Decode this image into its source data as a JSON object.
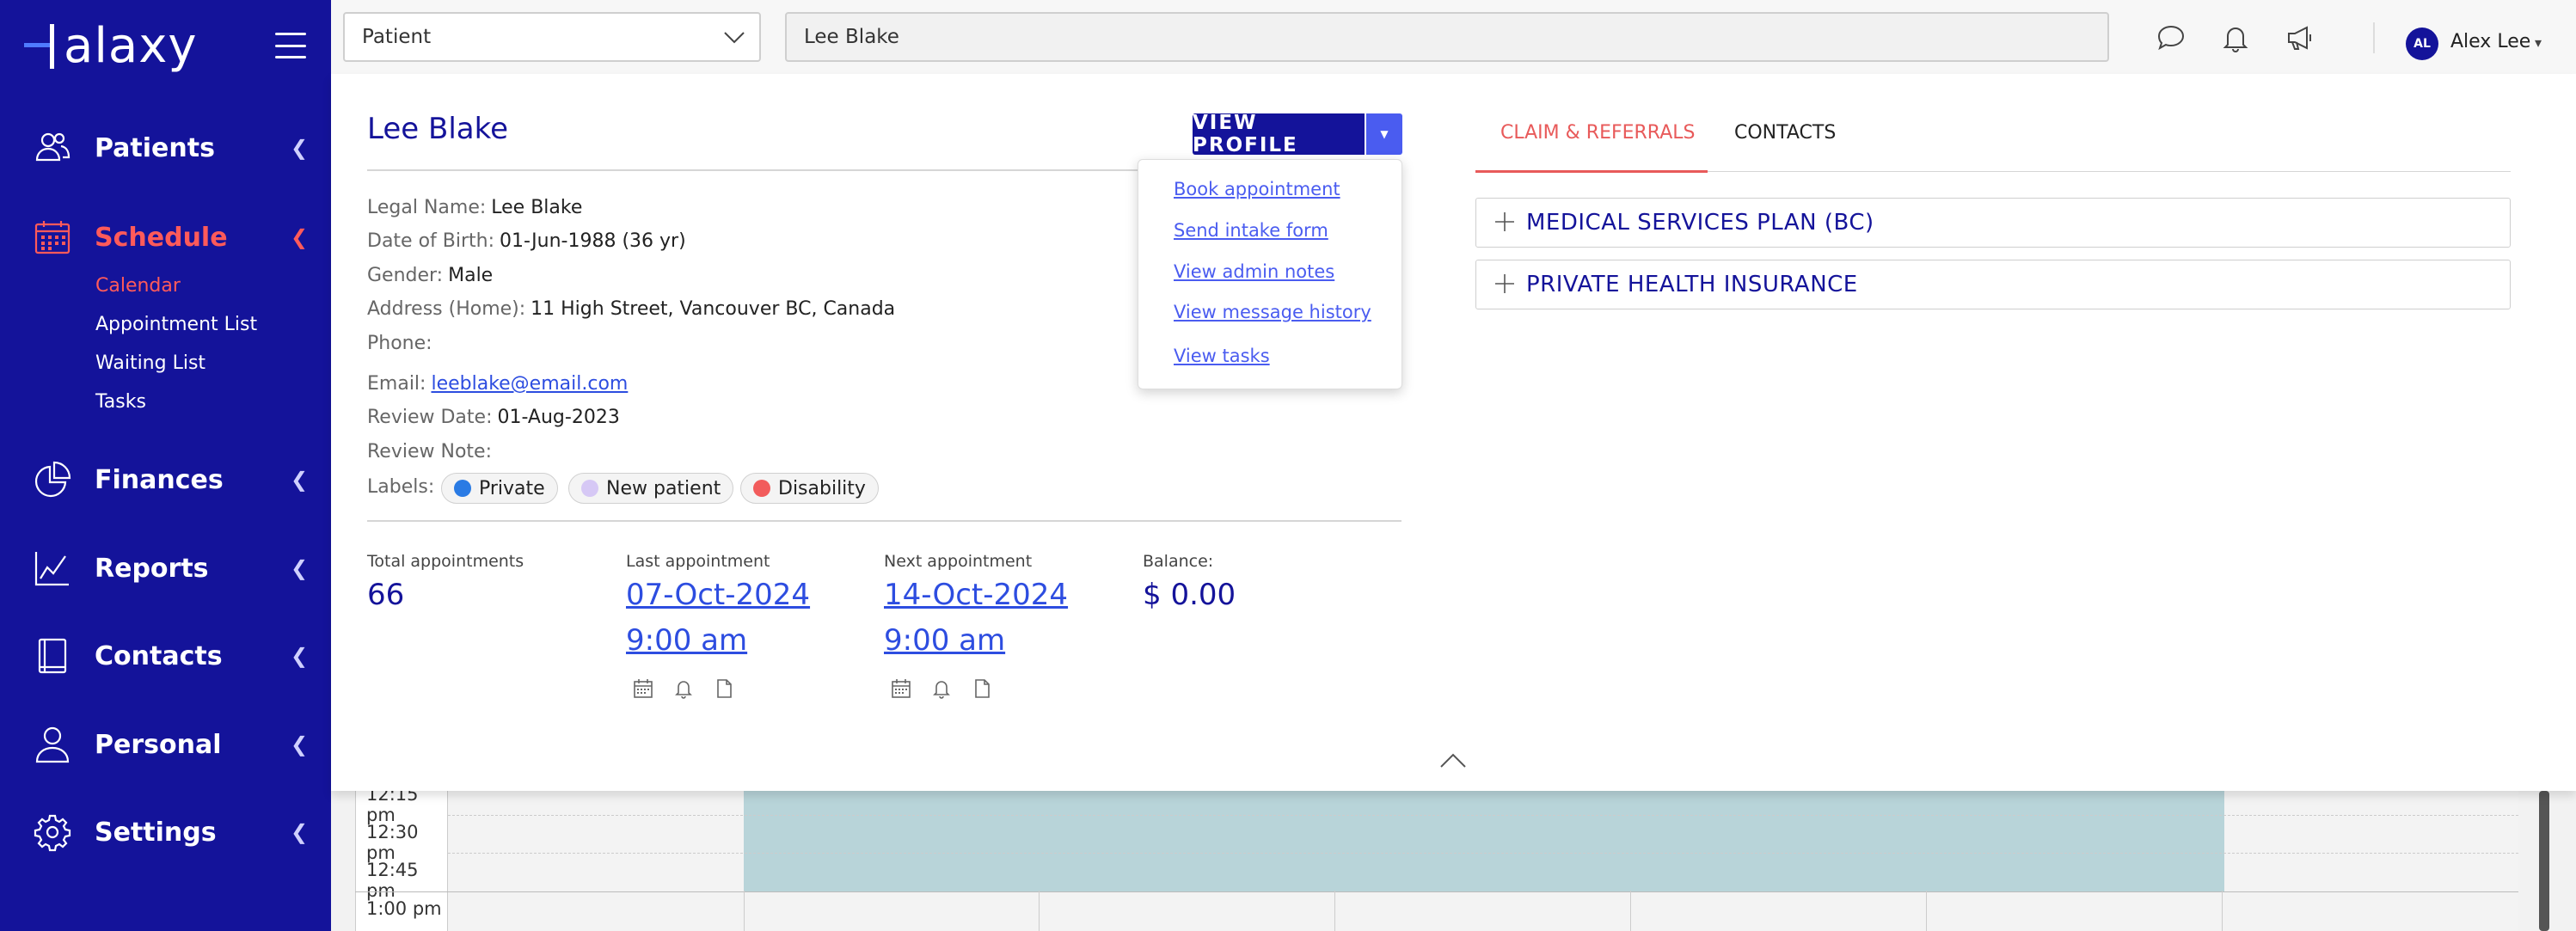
{
  "brand": {
    "logo_text": "alaxy"
  },
  "sidebar": {
    "items": [
      {
        "label": "Patients",
        "icon": "patients-icon"
      },
      {
        "label": "Schedule",
        "icon": "calendar-icon",
        "active": true,
        "subitems": [
          "Calendar",
          "Appointment List",
          "Waiting List",
          "Tasks"
        ]
      },
      {
        "label": "Finances",
        "icon": "pie-chart-icon"
      },
      {
        "label": "Reports",
        "icon": "line-chart-icon"
      },
      {
        "label": "Contacts",
        "icon": "book-icon"
      },
      {
        "label": "Personal",
        "icon": "person-icon"
      },
      {
        "label": "Settings",
        "icon": "gear-icon"
      }
    ]
  },
  "topbar": {
    "select_value": "Patient",
    "search_value": "Lee Blake",
    "user": {
      "initials": "AL",
      "name": "Alex Lee"
    }
  },
  "patient": {
    "name": "Lee Blake",
    "view_profile_label": "VIEW PROFILE",
    "fields": {
      "legal_name_label": "Legal Name:",
      "legal_name": "Lee Blake",
      "dob_label": "Date of Birth:",
      "dob": "01-Jun-1988 (36 yr)",
      "gender_label": "Gender:",
      "gender": "Male",
      "address_label": "Address (Home):",
      "address": "11 High Street, Vancouver BC, Canada",
      "phone_label": "Phone:",
      "email_label": "Email:",
      "email": "leeblake@email.com",
      "review_date_label": "Review Date:",
      "review_date": "01-Aug-2023",
      "review_note_label": "Review Note:",
      "labels_label": "Labels:"
    },
    "labels": [
      {
        "text": "Private",
        "color": "#2a7be4"
      },
      {
        "text": "New patient",
        "color": "#d6c8f5"
      },
      {
        "text": "Disability",
        "color": "#f25c5c"
      }
    ],
    "stats": {
      "total_label": "Total appointments",
      "total": "66",
      "last_label": "Last appointment",
      "last_date": "07-Oct-2024",
      "last_time": "9:00 am",
      "next_label": "Next appointment",
      "next_date": "14-Oct-2024",
      "next_time": "9:00 am",
      "balance_label": "Balance:",
      "balance": "$ 0.00"
    }
  },
  "dropdown": {
    "items": [
      "Book appointment",
      "Send intake form",
      "View admin notes",
      "View message history",
      "View tasks"
    ]
  },
  "tabs": [
    {
      "label": "CLAIM & REFERRALS",
      "active": true
    },
    {
      "label": "CONTACTS",
      "active": false
    }
  ],
  "accordions": [
    "MEDICAL SERVICES PLAN (BC)",
    "PRIVATE HEALTH INSURANCE"
  ],
  "calendar": {
    "times": [
      "12:15 pm",
      "12:30 pm",
      "12:45 pm",
      "1:00 pm"
    ]
  },
  "colors": {
    "primary": "#14139a",
    "accent": "#ff5a5a",
    "link": "#2d4de0"
  }
}
